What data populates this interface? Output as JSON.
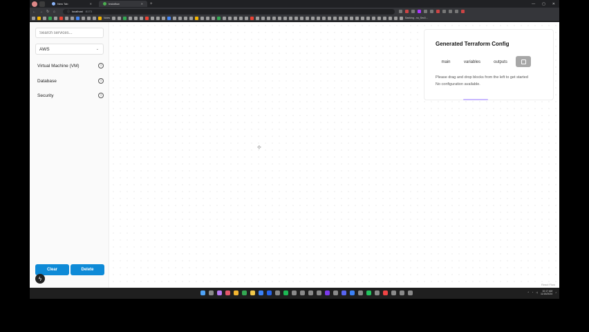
{
  "browser": {
    "tabs": [
      {
        "label": "New Tab"
      },
      {
        "label": "Instaflow"
      }
    ],
    "url_host": "localhost",
    "url_port": ":5173",
    "bookmark_labels": [
      "Notes",
      "Banking - no_Sec0..."
    ]
  },
  "sidebar": {
    "search_placeholder": "Search services...",
    "provider": "AWS",
    "services": [
      {
        "label": "Virtual Machine (VM)"
      },
      {
        "label": "Database"
      },
      {
        "label": "Security"
      }
    ],
    "clear_label": "Clear",
    "delete_label": "Delete",
    "badge_icon": "lightning-icon"
  },
  "panel": {
    "title": "Generated Terraform Config",
    "tabs": [
      "main",
      "variables",
      "outputs"
    ],
    "copy_icon": "copy-icon",
    "message_1": "Please drag and drop blocks from the left to get started",
    "message_2": "No configuration available."
  },
  "canvas": {
    "attribution": "React Flow"
  },
  "taskbar": {
    "time": "10:17 AM",
    "date": "11/18/2024"
  }
}
